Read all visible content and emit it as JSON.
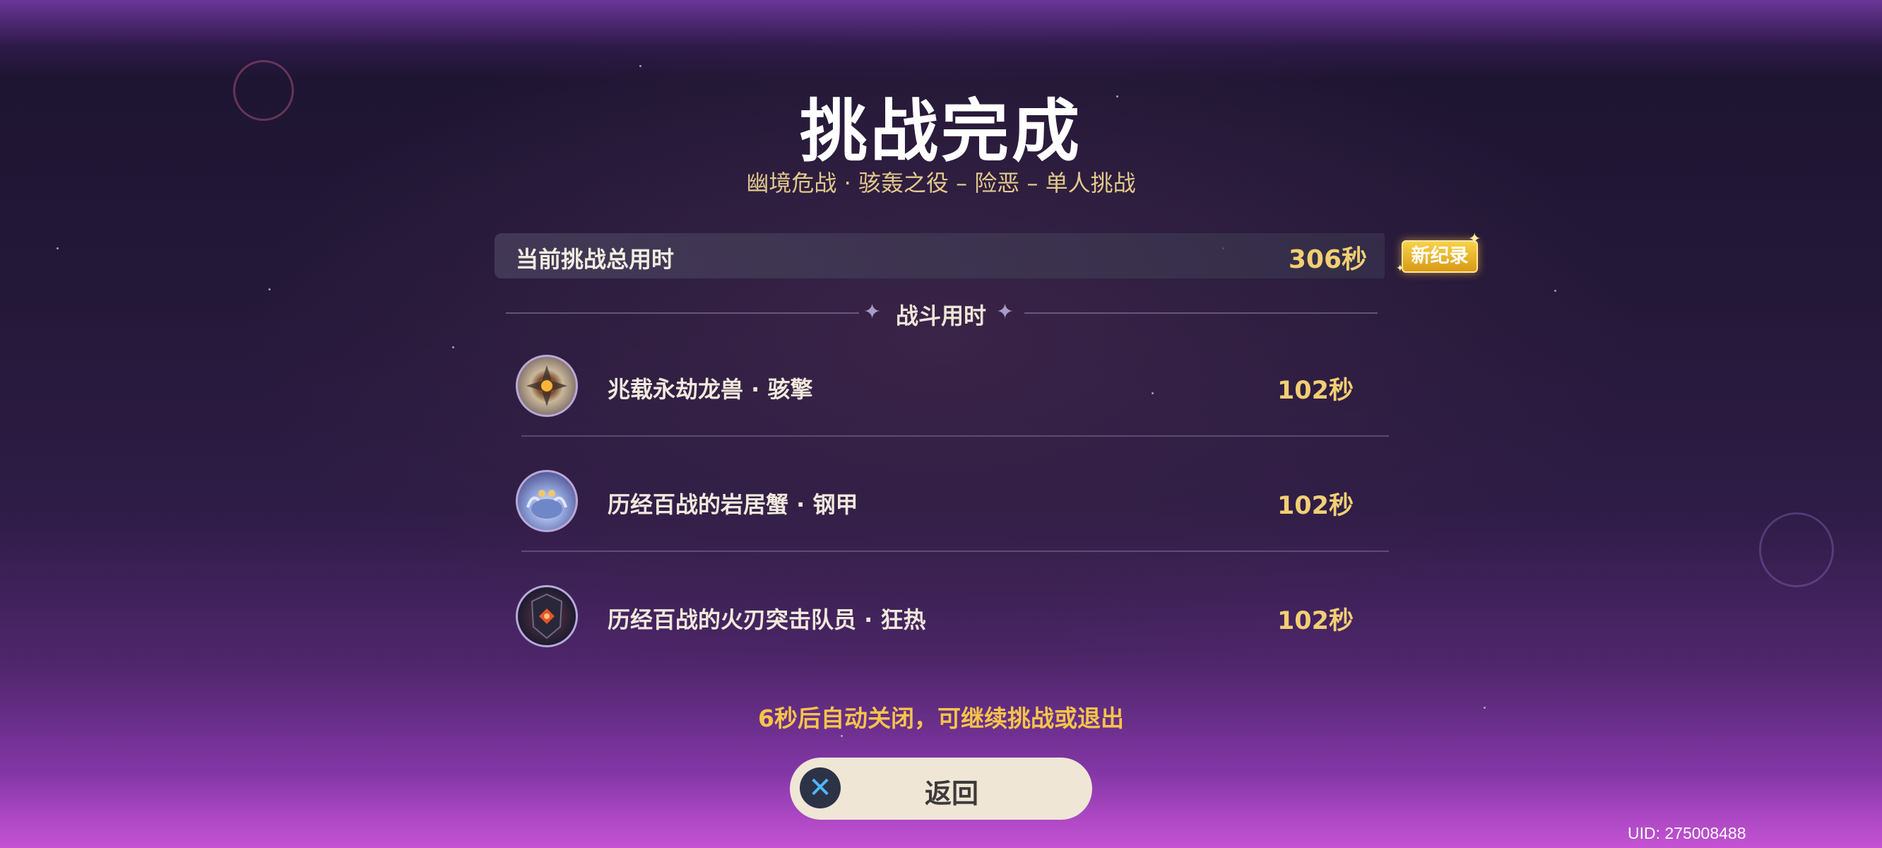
{
  "header": {
    "title": "挑战完成",
    "subtitle": "幽境危战 · 骇轰之役 – 险恶 – 单人挑战"
  },
  "total": {
    "label": "当前挑战总用时",
    "value": "306秒",
    "badge": "新纪录"
  },
  "section": {
    "title": "战斗用时"
  },
  "enemies": [
    {
      "name": "兆载永劫龙兽 · 骇擎",
      "time": "102秒",
      "icon": "dragon-beast-icon"
    },
    {
      "name": "历经百战的岩居蟹 · 钢甲",
      "time": "102秒",
      "icon": "rock-crab-icon"
    },
    {
      "name": "历经百战的火刃突击队员 · 狂热",
      "time": "102秒",
      "icon": "fire-blade-trooper-icon"
    }
  ],
  "footer": {
    "auto_close": "6秒后自动关闭，可继续挑战或退出",
    "return_label": "返回",
    "return_icon": "close-x-icon",
    "uid": "UID: 275008488"
  },
  "colors": {
    "gold": "#f2cf73",
    "badge": "#f8d24a",
    "button_bg": "#efe6d6",
    "accent_blue": "#4fb8ff"
  }
}
